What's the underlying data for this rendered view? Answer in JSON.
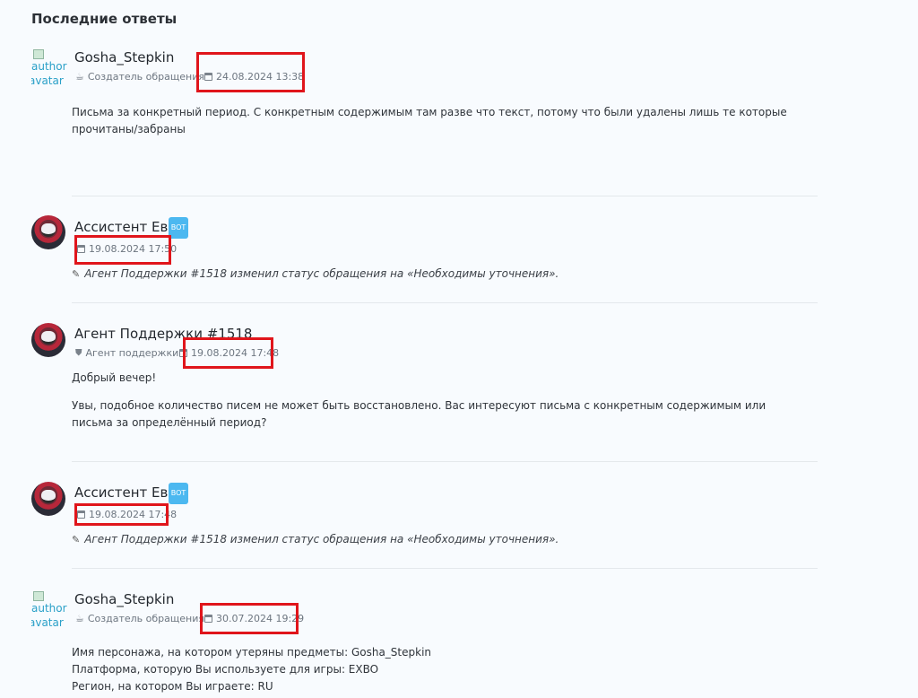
{
  "section_title": "Последние ответы",
  "broken_avatar_alt": [
    "author",
    "avatar"
  ],
  "bot_badge": "BOT",
  "entries": [
    {
      "author": "Gosha_Stepkin",
      "role": "Создатель обращения",
      "date": "24.08.2024 13:38",
      "paragraphs": [
        "Письма за конкретный период. С конкретным содержимым там разве что текст, потому что были удалены лишь те которые прочитаны/забраны"
      ]
    },
    {
      "author": "Ассистент Ева",
      "date": "19.08.2024 17:50",
      "status": "Агент Поддержки #1518 изменил статус обращения на «Необходимы уточнения»."
    },
    {
      "author": "Агент Поддержки #1518",
      "role": "Агент поддержки",
      "date": "19.08.2024 17:48",
      "paragraphs": [
        "Добрый вечер!",
        "Увы, подобное количество писем не может быть восстановлено. Вас интересуют письма с конкретным содержимым или письма за определённый период?"
      ]
    },
    {
      "author": "Ассистент Ева",
      "date": "19.08.2024 17:48",
      "status": "Агент Поддержки #1518 изменил статус обращения на «Необходимы уточнения»."
    },
    {
      "author": "Gosha_Stepkin",
      "role": "Создатель обращения",
      "date": "30.07.2024 19:29",
      "lines": [
        "Имя персонажа, на котором утеряны предметы: Gosha_Stepkin",
        "Платформа, которую Вы используете для игры: EXBO",
        "Регион, на котором Вы играете: RU"
      ]
    }
  ],
  "colors": {
    "highlight": "#e0151b",
    "bot_badge": "#4cb8f0",
    "background": "#f8fbfe"
  }
}
